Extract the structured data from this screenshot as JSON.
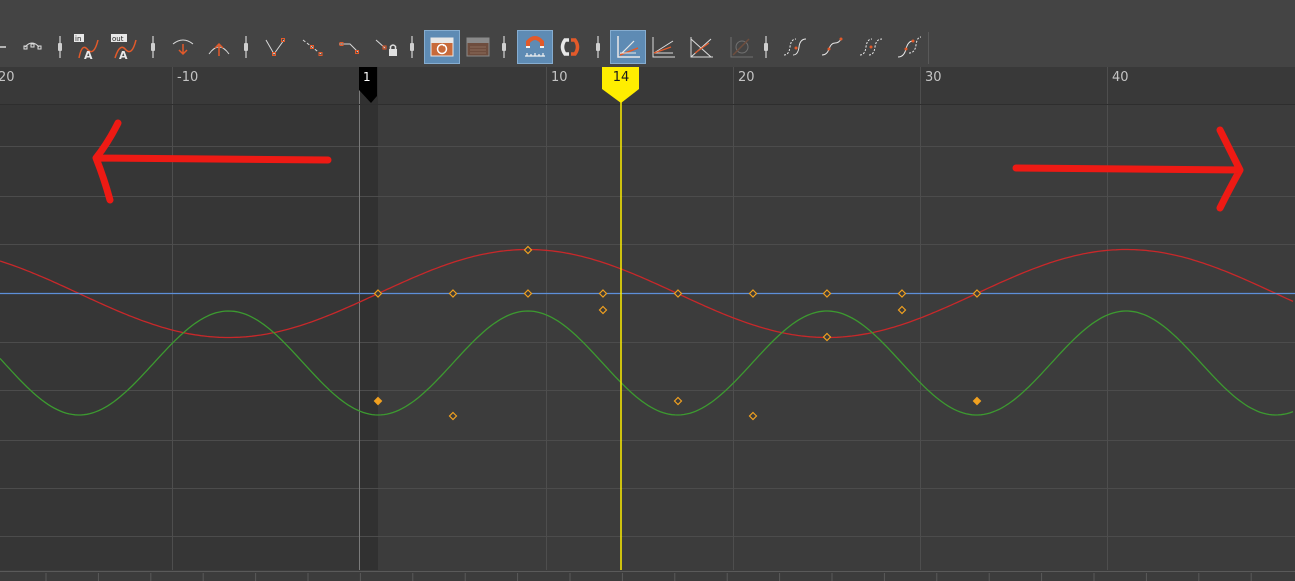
{
  "graph_editor": {
    "current_frame": "14",
    "start_frame": "1",
    "ruler_labels": [
      "20",
      "-10",
      "10",
      "20",
      "30",
      "40"
    ],
    "toolbar_icons": [
      "curve-tangent-icon",
      "in-tangent-icon",
      "out-tangent-icon",
      "tangent-break-icon",
      "tangent-unify-icon",
      "linear-tangent-icon",
      "stepped-tangent-icon",
      "flat-tangent-icon",
      "lock-tangent-icon",
      "auto-frame-icon",
      "frame-playback-icon",
      "magnet-snap-icon",
      "snap-values-icon",
      "normalize-icon",
      "normalize-flat-icon",
      "spread-icon",
      "reset-icon",
      "pre-infinity-icon",
      "post-infinity-icon",
      "cycle-icon",
      "cycle-offset-icon"
    ],
    "colors": {
      "red_curve": "#c8282a",
      "green_curve": "#3c9a30",
      "blue_curve": "#5d8fd8",
      "key_orange": "#f0a020",
      "playhead_yellow": "#ffee00",
      "annotation_red": "#ee1a14"
    }
  }
}
